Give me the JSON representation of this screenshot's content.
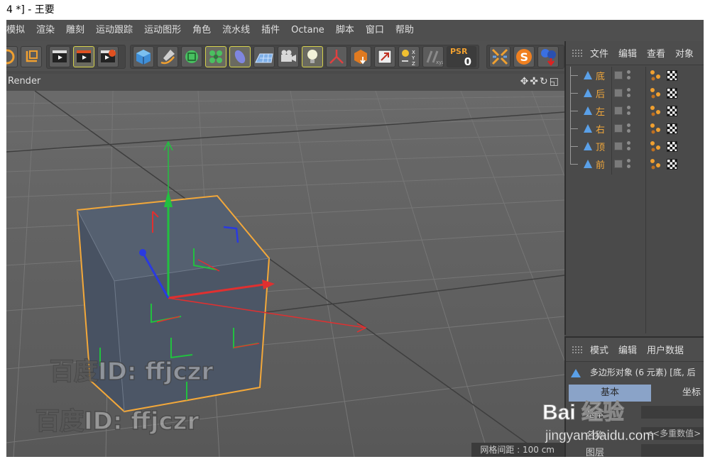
{
  "window": {
    "title": "4 *] - 王要"
  },
  "menubar": {
    "items": [
      "模拟",
      "渲染",
      "雕刻",
      "运动跟踪",
      "运动图形",
      "角色",
      "流水线",
      "插件",
      "Octane",
      "脚本",
      "窗口",
      "帮助"
    ]
  },
  "toolbar": {
    "psr_label": "PSR",
    "psr_value": "0",
    "xyz_label": "X Y Z"
  },
  "viewport": {
    "title": "Render",
    "nav_icons": "✥✜↻◱",
    "grid_spacing": "网格间距 : 100 cm"
  },
  "object_manager": {
    "tabs": [
      "文件",
      "编辑",
      "查看",
      "对象"
    ],
    "objects": [
      {
        "name": "底"
      },
      {
        "name": "后"
      },
      {
        "name": "左"
      },
      {
        "name": "右"
      },
      {
        "name": "顶"
      },
      {
        "name": "前"
      }
    ]
  },
  "attribute_manager": {
    "tabs": [
      "模式",
      "编辑",
      "用户数据"
    ],
    "info": "多边形对象 (6 元素) [底, 后",
    "subtabs": [
      "基本",
      "坐标"
    ],
    "rows": [
      {
        "label": "基本",
        "value": ""
      },
      {
        "label": "名称",
        "value": "<<多重数值>"
      },
      {
        "label": "图层",
        "value": ""
      }
    ]
  },
  "watermarks": {
    "text": "百度ID: ffjczr",
    "logo_text": "Bai 经验",
    "logo_url": "jingyan.baidu.com"
  },
  "colors": {
    "selection_orange": "#f3a83a",
    "axis_x": "#e03030",
    "axis_y": "#22c040",
    "axis_z": "#2a3ae0"
  }
}
